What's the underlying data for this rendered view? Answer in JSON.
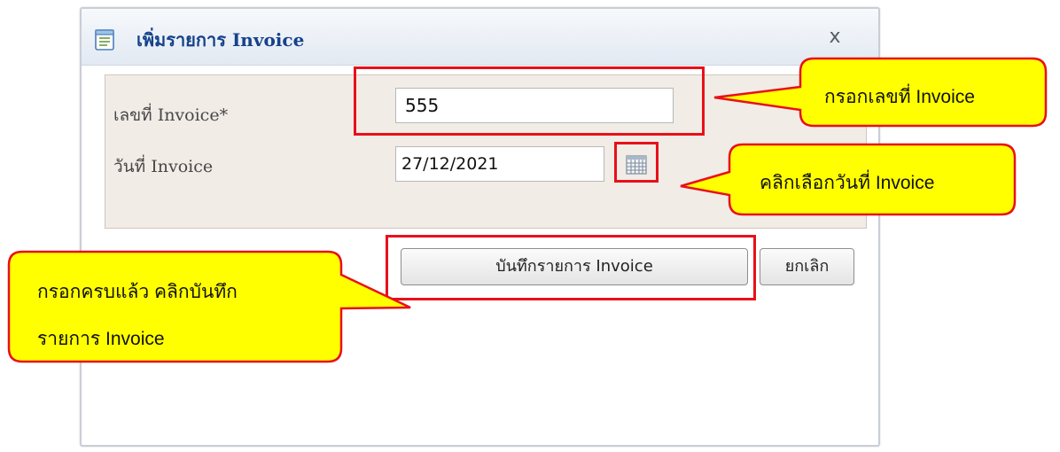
{
  "dialog": {
    "title": "เพิ่มรายการ Invoice",
    "close_label": "x"
  },
  "form": {
    "invoice_number_label": "เลขที่ Invoice*",
    "invoice_number_value": "555",
    "invoice_date_label": "วันที่ Invoice",
    "invoice_date_value": "27/12/2021"
  },
  "buttons": {
    "save_label": "บันทึกรายการ Invoice",
    "cancel_label": "ยกเลิก"
  },
  "callouts": {
    "enter_invoice_number": "กรอกเลขที่ Invoice",
    "pick_invoice_date": "คลิกเลือกวันที่ Invoice",
    "save_hint_line1": "กรอกครบแล้ว คลิกบันทึก",
    "save_hint_line2": "รายการ Invoice"
  },
  "colors": {
    "title_text": "#15428b",
    "highlight_border": "#e8101a",
    "callout_fill": "#ffff00",
    "callout_border": "#e8101a",
    "form_background": "#f1ece6"
  },
  "icons": {
    "title": "document-list-icon",
    "close": "close-icon",
    "date_picker": "calendar-icon"
  }
}
